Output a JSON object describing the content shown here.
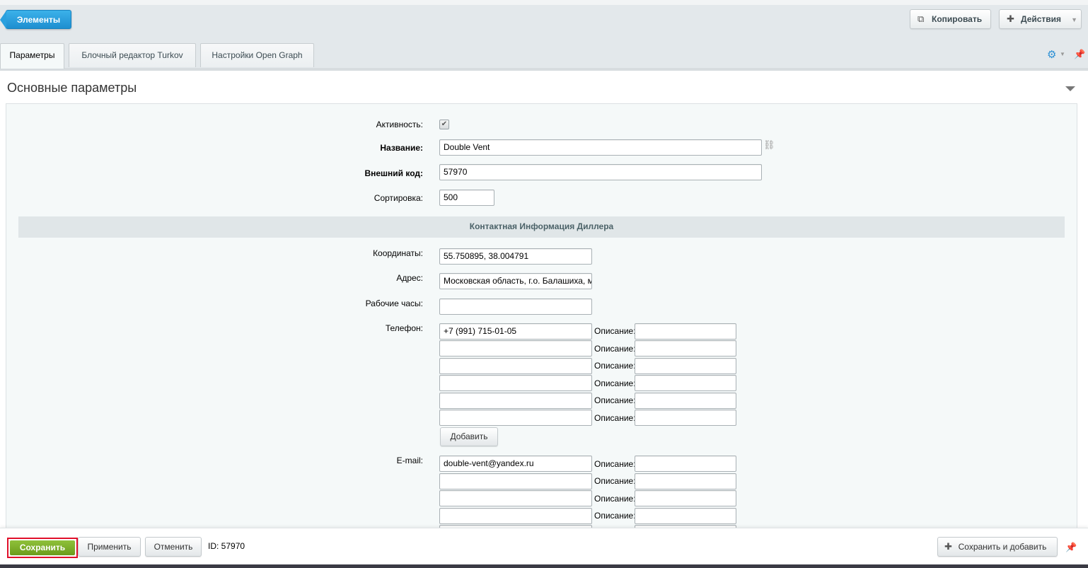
{
  "toolbar": {
    "back_label": "Элементы",
    "copy_label": "Копировать",
    "actions_label": "Действия"
  },
  "tabs": [
    {
      "label": "Параметры",
      "active": true
    },
    {
      "label": "Блочный редактор Turkov",
      "active": false
    },
    {
      "label": "Настройки Open Graph",
      "active": false
    }
  ],
  "section": {
    "title": "Основные параметры"
  },
  "form": {
    "active_label": "Активность:",
    "active_checked": true,
    "name_label": "Название:",
    "name_value": "Double Vent",
    "xml_id_label": "Внешний код:",
    "xml_id_value": "57970",
    "sort_label": "Сортировка:",
    "sort_value": "500"
  },
  "dealer": {
    "group_title": "Контактная Информация Диллера",
    "coords_label": "Координаты:",
    "coords_value": "55.750895, 38.004791",
    "address_label": "Адрес:",
    "address_value": "Московская область, г.о. Балашиха, м",
    "hours_label": "Рабочие часы:",
    "hours_value": "",
    "phone_label": "Телефон:",
    "phones": [
      "+7 (991) 715-01-05",
      "",
      "",
      "",
      "",
      ""
    ],
    "description_label": "Описание:",
    "add_button": "Добавить",
    "email_label": "E-mail:",
    "emails": [
      "double-vent@yandex.ru",
      "",
      "",
      "",
      ""
    ]
  },
  "footer": {
    "save_label": "Сохранить",
    "apply_label": "Применить",
    "cancel_label": "Отменить",
    "id_text": "ID: 57970",
    "save_add_label": "Сохранить и добавить"
  },
  "colors": {
    "accent_blue": "#1e8fd0",
    "save_green": "#7aab25",
    "highlight_red": "#e0102a"
  }
}
